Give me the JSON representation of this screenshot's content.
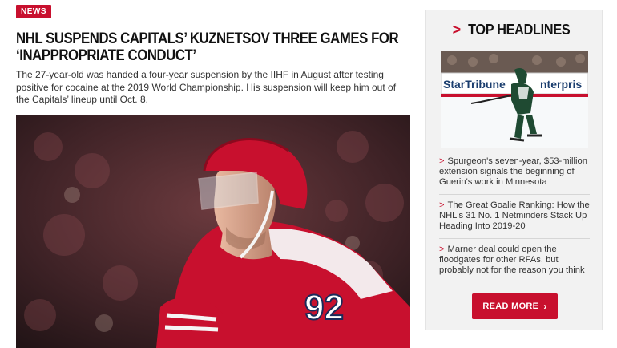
{
  "article": {
    "badge": "NEWS",
    "headline": "NHL SUSPENDS CAPITALS’ KUZNETSOV THREE GAMES FOR ‘INAPPROPRIATE CONDUCT’",
    "dek": "The 27-year-old was handed a four-year suspension by the IIHF in August after testing positive for cocaine at the 2019 World Championship. His suspension will keep him out of the Capitals’ lineup until Oct. 8.",
    "hero_jersey_number": "92"
  },
  "sidebar": {
    "title_chevron": ">",
    "title": "TOP HEADLINES",
    "thumb_board_left": "StarTribune",
    "thumb_board_right": "nterpris",
    "stories": [
      {
        "arrow": ">",
        "text": "Spurgeon's seven-year, $53-million extension signals the beginning of Guerin's work in Minnesota"
      },
      {
        "arrow": ">",
        "text": "The Great Goalie Ranking: How the NHL's 31 No. 1 Netminders Stack Up Heading Into 2019-20"
      },
      {
        "arrow": ">",
        "text": "Marner deal could open the floodgates for other RFAs, but probably not for the reason you think"
      }
    ],
    "read_more": "READ MORE",
    "read_more_icon": "chevron-right-icon"
  },
  "colors": {
    "accent": "#c8102e",
    "sidebar_bg": "#f2f2f2"
  }
}
